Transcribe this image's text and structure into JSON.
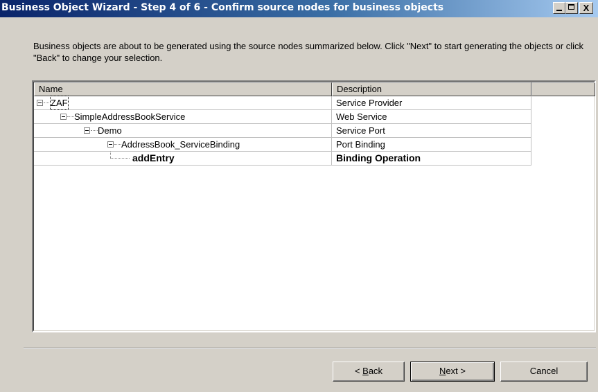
{
  "window": {
    "title": "Business Object Wizard - Step 4 of 6 - Confirm source nodes for business objects",
    "controls": {
      "minimize": "_",
      "maximize": "□",
      "close": "X"
    }
  },
  "intro_text": "Business objects are about to be generated using the source nodes summarized below. Click \"Next\" to start generating the objects or click \"Back\" to change your selection.",
  "list": {
    "columns": [
      "Name",
      "Description",
      ""
    ],
    "rows": [
      {
        "name": "ZAF",
        "description": "Service Provider",
        "level": 0,
        "expanded": true,
        "bold": false
      },
      {
        "name": "SimpleAddressBookService",
        "description": "Web Service",
        "level": 1,
        "expanded": true,
        "bold": false
      },
      {
        "name": "Demo",
        "description": "Service Port",
        "level": 2,
        "expanded": true,
        "bold": false
      },
      {
        "name": "AddressBook_ServiceBinding",
        "description": "Port Binding",
        "level": 3,
        "expanded": true,
        "bold": false
      },
      {
        "name": "addEntry",
        "description": "Binding Operation",
        "level": 4,
        "expanded": false,
        "bold": true
      }
    ]
  },
  "buttons": {
    "back": {
      "pre": "< ",
      "accel": "B",
      "post": "ack"
    },
    "next": {
      "pre": "",
      "accel": "N",
      "post": "ext >"
    },
    "cancel": "Cancel"
  }
}
